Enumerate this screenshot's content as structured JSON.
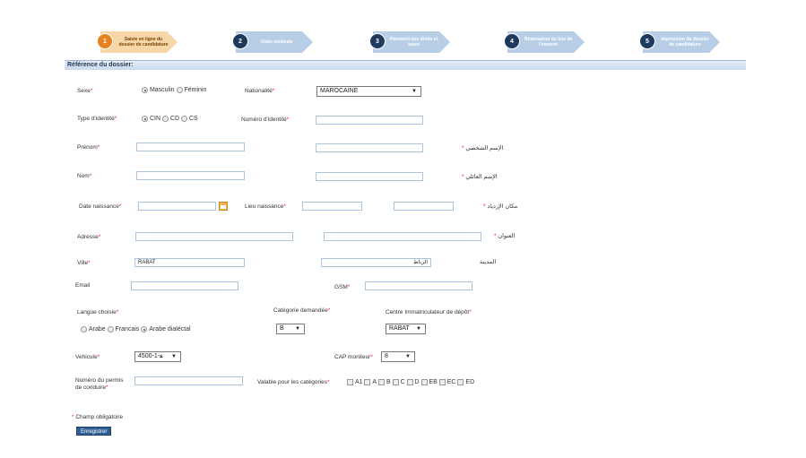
{
  "steps": [
    {
      "num": "1",
      "label": "Saisie en ligne du dossier de candidature"
    },
    {
      "num": "2",
      "label": "Visite médicale"
    },
    {
      "num": "3",
      "label": "Paiement des droits et taxes"
    },
    {
      "num": "4",
      "label": "Réservation du box de l'examen"
    },
    {
      "num": "5",
      "label": "Impression du dossier de candidature"
    }
  ],
  "section_title": "Référence du dossier:",
  "required_mark": "*",
  "fields": {
    "sexe": {
      "label": "Sexe",
      "options": [
        "Masculin",
        "Féminin"
      ],
      "selected": "Masculin"
    },
    "nationalite": {
      "label": "Nationalité",
      "value": "MAROCAINE"
    },
    "type_identite": {
      "label": "Type d'identité",
      "options": [
        "CIN",
        "CD",
        "CS"
      ],
      "selected": "CIN"
    },
    "numero_identite": {
      "label": "Numéro d'identité",
      "value": ""
    },
    "prenom": {
      "label": "Prénom",
      "value": "",
      "ar_label": "الإسم الشخصي"
    },
    "nom": {
      "label": "Nom",
      "value": "",
      "ar_label": "الإسم العائلي"
    },
    "date_naissance": {
      "label": "Date naissance",
      "value": ""
    },
    "lieu_naissance": {
      "label": "Lieu naissance",
      "value": "",
      "ar_label": "مكان الإزدياد"
    },
    "adresse": {
      "label": "Adresse",
      "value": "",
      "ar_label": "العنوان"
    },
    "ville": {
      "label": "Ville",
      "value": "RABAT",
      "ar_value": "الرباط",
      "ar_label": "المدينة"
    },
    "email": {
      "label": "Email",
      "value": ""
    },
    "gsm": {
      "label": "GSM",
      "value": ""
    },
    "langue": {
      "label": "Langue choisie",
      "options": [
        "Arabe",
        "Francais",
        "Arabe dialéctal"
      ],
      "selected": "Arabe dialéctal"
    },
    "categorie": {
      "label": "Catégorie demandée",
      "value": "B"
    },
    "centre": {
      "label": "Centre Immatriculateur de dépôt",
      "value": "RABAT"
    },
    "vehicule": {
      "label": "Vehicule",
      "value": "4500-1-ﻫ"
    },
    "cap": {
      "label": "CAP moniteur",
      "value": "8"
    },
    "permis": {
      "label_line1": "Numéro du permis",
      "label_line2": "de conduire",
      "value": ""
    },
    "valable": {
      "label": "Valable pour les catégories",
      "options": [
        "A1",
        "A",
        "B",
        "C",
        "D",
        "EB",
        "EC",
        "ED"
      ]
    }
  },
  "footer": {
    "required_note": "Champ obligatoire",
    "save_label": "Enregistrer"
  }
}
